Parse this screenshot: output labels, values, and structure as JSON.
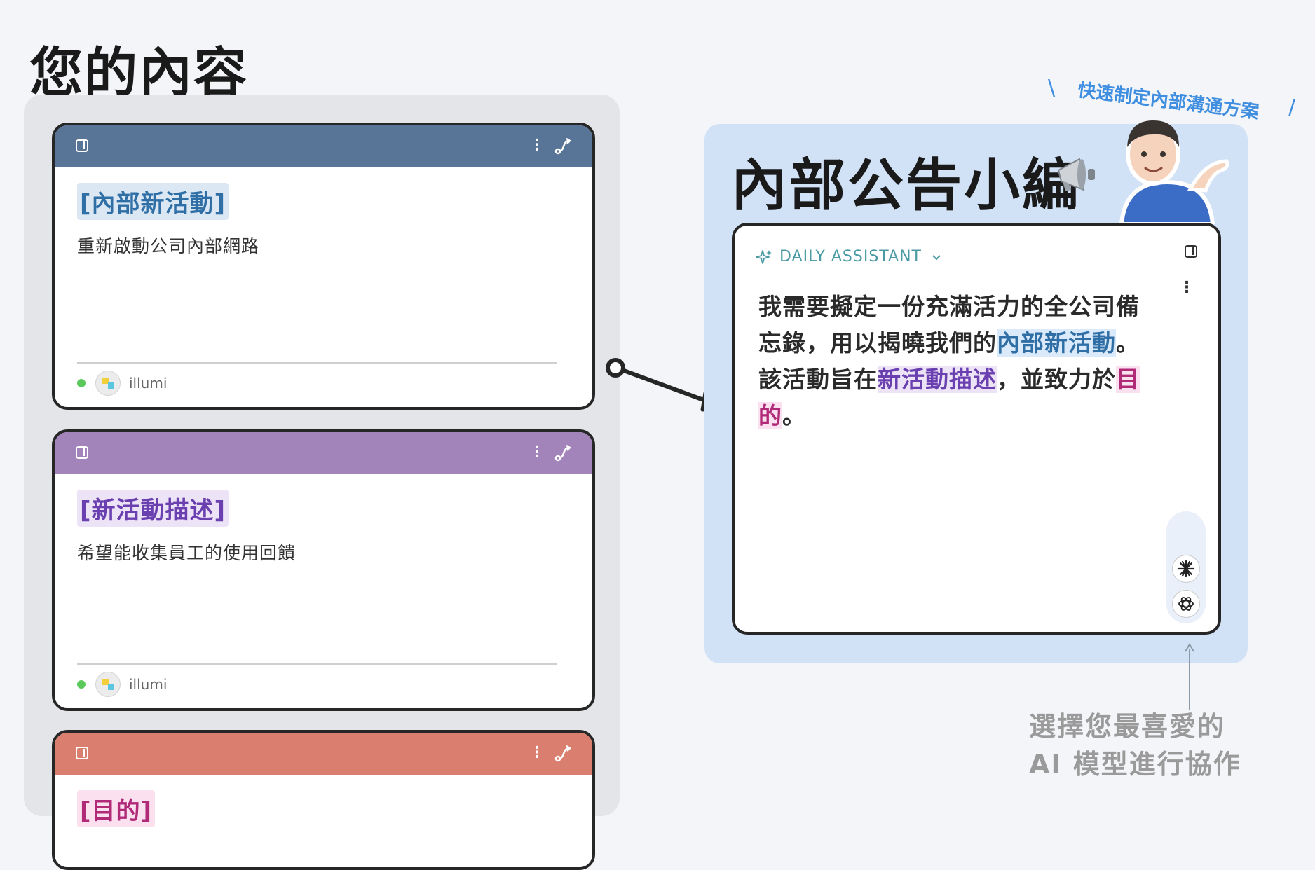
{
  "page": {
    "title": "您的內容"
  },
  "cards": [
    {
      "tag": "[內部新活動]",
      "description": "重新啟動公司內部網路",
      "author": "illumi",
      "header_color": "#587497",
      "tag_color": "#2f6fa6",
      "tag_bg": "#dbe8f4"
    },
    {
      "tag": "[新活動描述]",
      "description": "希望能收集員工的使用回饋",
      "author": "illumi",
      "header_color": "#a283ba",
      "tag_color": "#6a3fb0",
      "tag_bg": "#ece3f7"
    },
    {
      "tag": "[目的]",
      "header_color": "#da7f70",
      "tag_color": "#b02a78",
      "tag_bg": "#fbe1ef"
    }
  ],
  "tagline": "快速制定內部溝通方案",
  "assistant": {
    "title": "內部公告小編",
    "label": "DAILY ASSISTANT",
    "prompt": {
      "seg1": "我需要擬定一份充滿活力的全公司備忘錄，用以揭曉我們的",
      "var1": "內部新活動",
      "seg2": "。該活動旨在",
      "var2": "新活動描述",
      "seg3": "，並致力於",
      "var3": "目的",
      "seg4": "。"
    },
    "models": [
      "claude-icon",
      "openai-icon"
    ]
  },
  "hint": {
    "line1": "選擇您最喜愛的",
    "line2": "AI 模型進行協作"
  }
}
